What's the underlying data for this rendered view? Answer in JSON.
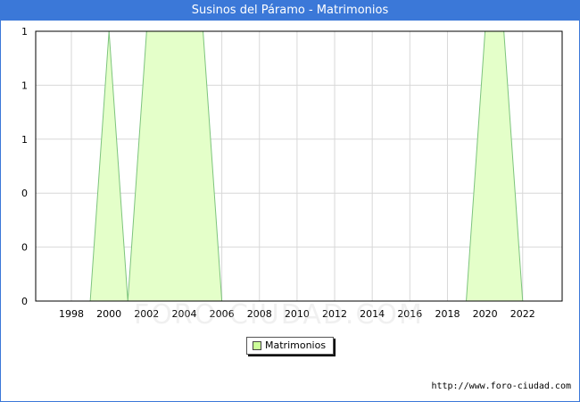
{
  "chart_data": {
    "type": "area",
    "title": "Susinos del Páramo - Matrimonios",
    "xlabel": "",
    "ylabel": "",
    "x": [
      1999,
      2000,
      2001,
      2002,
      2003,
      2004,
      2005,
      2006,
      2007,
      2008,
      2009,
      2010,
      2011,
      2012,
      2013,
      2014,
      2015,
      2016,
      2017,
      2018,
      2019,
      2020,
      2021,
      2022
    ],
    "series": [
      {
        "name": "Matrimonios",
        "values": [
          0,
          1,
          0,
          1,
          1,
          1,
          1,
          0,
          0,
          0,
          0,
          0,
          0,
          0,
          0,
          0,
          0,
          0,
          0,
          0,
          0,
          1,
          1,
          0
        ]
      }
    ],
    "x_ticks": [
      "1998",
      "2000",
      "2002",
      "2004",
      "2006",
      "2008",
      "2010",
      "2012",
      "2014",
      "2016",
      "2018",
      "2020",
      "2022"
    ],
    "y_ticks": [
      "0",
      "0",
      "0",
      "1",
      "1",
      "1"
    ],
    "xlim": [
      1996.1,
      2024.1
    ],
    "ylim": [
      0,
      1
    ],
    "grid": true,
    "legend_position": "bottom-center",
    "colors": {
      "fill": "#e4ffc9",
      "line": "#7dc47d",
      "grid": "#d8d8d8",
      "header": "#3b78d8",
      "legend_swatch": "#ccff99"
    }
  },
  "watermark": "FORO-CIUDAD.COM",
  "source_url": "http://www.foro-ciudad.com"
}
